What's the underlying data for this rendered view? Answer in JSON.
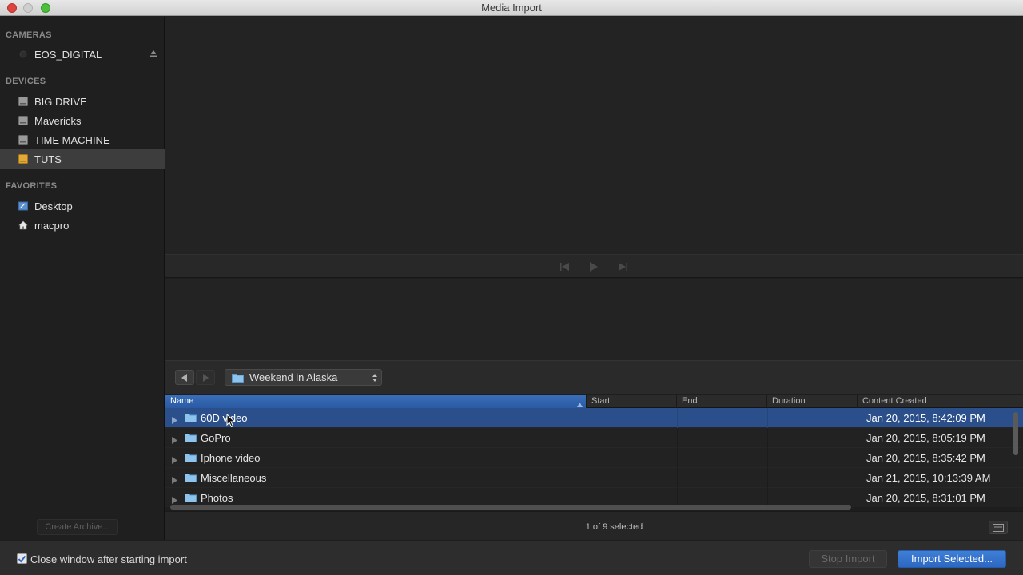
{
  "window": {
    "title": "Media Import"
  },
  "sidebar": {
    "sections": [
      {
        "header": "CAMERAS",
        "items": [
          {
            "label": "EOS_DIGITAL",
            "icon": "camera-icon"
          }
        ]
      },
      {
        "header": "DEVICES",
        "items": [
          {
            "label": "BIG DRIVE",
            "icon": "hard-drive-icon"
          },
          {
            "label": "Mavericks",
            "icon": "hard-drive-icon"
          },
          {
            "label": "TIME MACHINE",
            "icon": "hard-drive-icon"
          },
          {
            "label": "TUTS",
            "icon": "external-drive-icon",
            "selected": true
          }
        ]
      },
      {
        "header": "FAVORITES",
        "items": [
          {
            "label": "Desktop",
            "icon": "desktop-icon"
          },
          {
            "label": "macpro",
            "icon": "home-icon"
          }
        ]
      }
    ],
    "create_archive_label": "Create Archive..."
  },
  "browser": {
    "current_folder": "Weekend in Alaska",
    "columns": {
      "name": "Name",
      "start": "Start",
      "end": "End",
      "duration": "Duration",
      "content_created": "Content Created"
    },
    "rows": [
      {
        "name": "60D video",
        "created": "Jan 20, 2015, 8:42:09 PM",
        "selected": true
      },
      {
        "name": "GoPro",
        "created": "Jan 20, 2015, 8:05:19 PM"
      },
      {
        "name": "Iphone video",
        "created": "Jan 20, 2015, 8:35:42 PM"
      },
      {
        "name": "Miscellaneous",
        "created": "Jan 21, 2015, 10:13:39 AM"
      },
      {
        "name": "Photos",
        "created": "Jan 20, 2015, 8:31:01 PM"
      }
    ],
    "status": "1 of 9 selected"
  },
  "footer": {
    "close_window_label": "Close window after starting import",
    "close_window_checked": true,
    "stop_import_label": "Stop Import",
    "import_selected_label": "Import Selected..."
  },
  "colors": {
    "accent": "#2d68c2",
    "selection": "#2a4f8a"
  }
}
